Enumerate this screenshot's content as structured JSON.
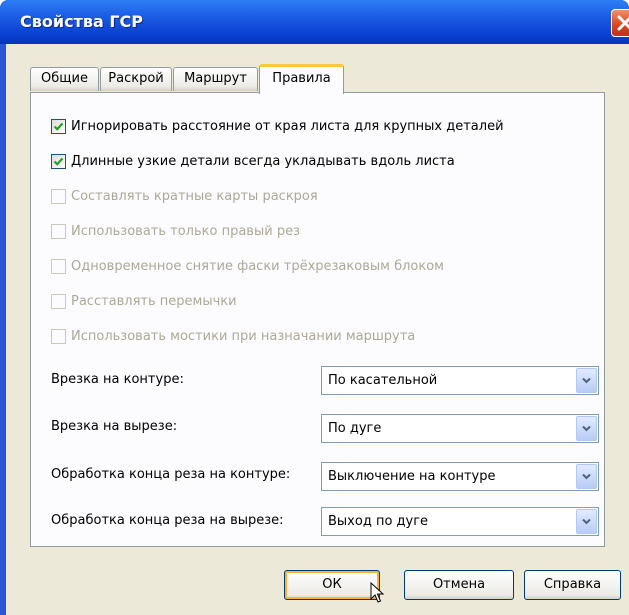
{
  "window": {
    "title": "Свойства ГСР"
  },
  "tabs": [
    {
      "label": "Общие",
      "active": false
    },
    {
      "label": "Раскрой",
      "active": false
    },
    {
      "label": "Маршрут",
      "active": false
    },
    {
      "label": "Правила",
      "active": true
    }
  ],
  "checkboxes": [
    {
      "label": "Игнорировать расстояние от края листа для крупных деталей",
      "checked": true,
      "enabled": true
    },
    {
      "label": "Длинные узкие детали всегда укладывать вдоль листа",
      "checked": true,
      "enabled": true
    },
    {
      "label": "Составлять кратные карты раскроя",
      "checked": false,
      "enabled": false
    },
    {
      "label": "Использовать только правый рез",
      "checked": false,
      "enabled": false
    },
    {
      "label": "Одновременное снятие фаски трёхрезаковым блоком",
      "checked": false,
      "enabled": false
    },
    {
      "label": "Расставлять перемычки",
      "checked": false,
      "enabled": false
    },
    {
      "label": "Использовать мостики при назначании маршрута",
      "checked": false,
      "enabled": false
    }
  ],
  "fields": [
    {
      "label": "Врезка на контуре:",
      "value": "По касательной"
    },
    {
      "label": "Врезка на вырезе:",
      "value": "По дуге"
    },
    {
      "label": "Обработка конца реза на контуре:",
      "value": "Выключение на контуре"
    },
    {
      "label": "Обработка конца реза на вырезе:",
      "value": "Выход по дуге"
    }
  ],
  "buttons": {
    "ok": "ОК",
    "cancel": "Отмена",
    "help": "Справка"
  },
  "icons": {
    "close": "close-icon",
    "checkmark": "checkmark-icon",
    "dropdown": "chevron-down-icon",
    "cursor": "mouse-cursor-icon"
  },
  "colors": {
    "title_bar": "#0a3fcf",
    "check": "#21a121",
    "disabled_text": "#aca899",
    "dialog_bg": "#ece9d8",
    "default_button_ring": "#f8b336"
  }
}
